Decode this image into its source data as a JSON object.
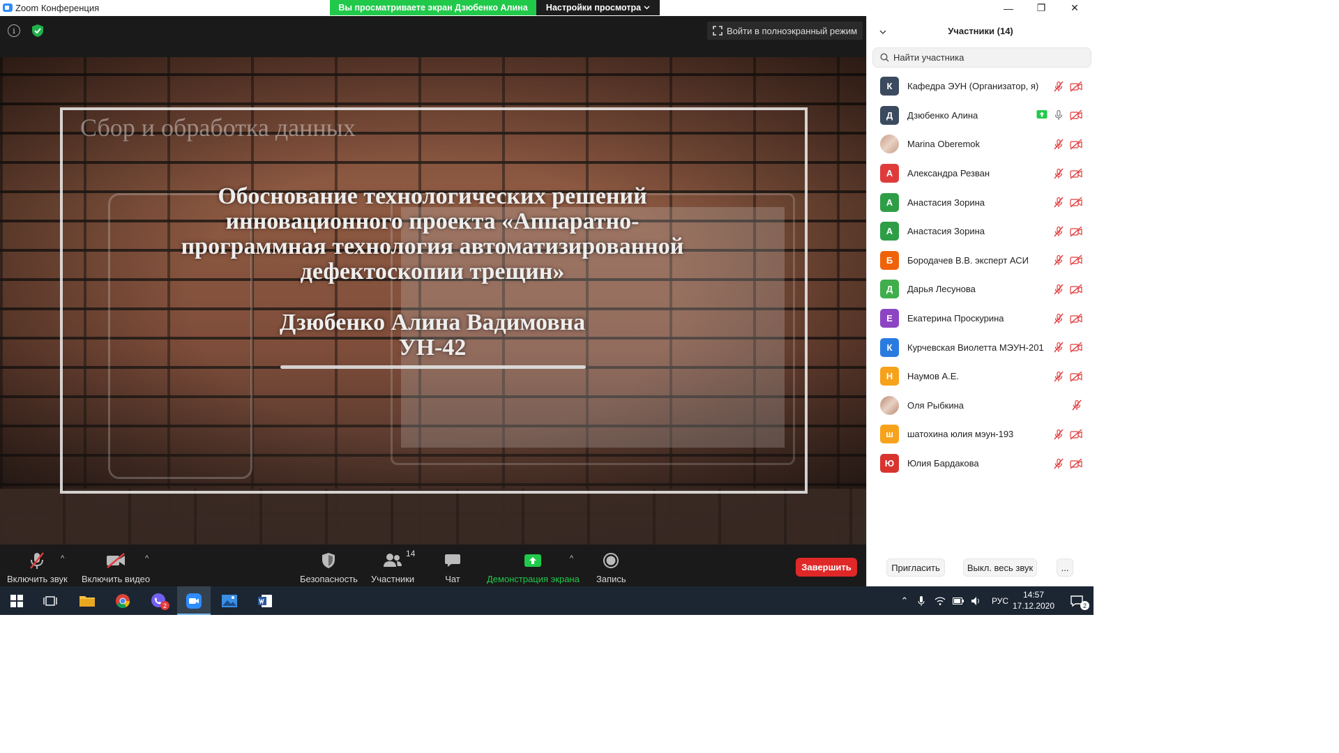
{
  "window": {
    "title": "Zoom Конференция",
    "minimize_glyph": "—",
    "restore_glyph": "❐",
    "close_glyph": "✕"
  },
  "share_banner": {
    "viewing_text": "Вы просматриваете экран Дзюбенко Алина",
    "view_settings_label": "Настройки просмотра"
  },
  "meeting_topbar": {
    "info_glyph": "i",
    "fullscreen_label": "Войти в полноэкранный режим"
  },
  "slide": {
    "header": "Сбор и обработка данных",
    "title_lines": [
      "Обоснование технологических решений",
      "инновационного проекта «Аппаратно-",
      "программная технология автоматизированной",
      "дефектоскопии трещин»"
    ],
    "author_lines": [
      "Дзюбенко Алина Вадимовна",
      "УН-42"
    ]
  },
  "toolbar": {
    "unmute_label": "Включить звук",
    "start_video_label": "Включить видео",
    "security_label": "Безопасность",
    "participants_label": "Участники",
    "participants_count": "14",
    "chat_label": "Чат",
    "share_screen_label": "Демонстрация экрана",
    "record_label": "Запись",
    "end_label": "Завершить",
    "caret_glyph": "^"
  },
  "panel": {
    "title": "Участники (14)",
    "search_placeholder": "Найти участника",
    "participants": [
      {
        "initial": "К",
        "name": "Кафедра ЭУН (Организатор, я)",
        "color": "#3b4a5e",
        "mic": "muted",
        "video": "off"
      },
      {
        "initial": "Д",
        "name": "Дзюбенко Алина",
        "color": "#3b4a5e",
        "mic": "on",
        "video": "off",
        "sharing": true
      },
      {
        "initial": "",
        "name": "Marina Oberemok",
        "color": "#c89a86",
        "mic": "muted",
        "video": "off",
        "photo": true
      },
      {
        "initial": "А",
        "name": "Александра Резван",
        "color": "#e03b3b",
        "mic": "muted",
        "video": "off"
      },
      {
        "initial": "А",
        "name": "Анастасия Зорина",
        "color": "#2e9e46",
        "mic": "muted",
        "video": "off"
      },
      {
        "initial": "А",
        "name": "Анастасия Зорина",
        "color": "#2e9e46",
        "mic": "muted",
        "video": "off"
      },
      {
        "initial": "Б",
        "name": "Бородачев В.В. эксперт АСИ",
        "color": "#f0620a",
        "mic": "muted",
        "video": "off"
      },
      {
        "initial": "Д",
        "name": "Дарья Лесунова",
        "color": "#3fae4b",
        "mic": "muted",
        "video": "off"
      },
      {
        "initial": "Е",
        "name": "Екатерина Проскурина",
        "color": "#8c44c4",
        "mic": "muted",
        "video": "off"
      },
      {
        "initial": "К",
        "name": "Курчевская Виолетта МЭУН-201",
        "color": "#2a7be0",
        "mic": "muted",
        "video": "off"
      },
      {
        "initial": "Н",
        "name": "Наумов А.Е.",
        "color": "#f7a21b",
        "mic": "muted",
        "video": "off"
      },
      {
        "initial": "",
        "name": "Оля Рыбкина",
        "color": "#b9876e",
        "mic": "muted",
        "video": "none",
        "photo": true
      },
      {
        "initial": "ш",
        "name": "шатохина юлия мэун-193",
        "color": "#f7a21b",
        "mic": "muted",
        "video": "off"
      },
      {
        "initial": "Ю",
        "name": "Юлия Бардакова",
        "color": "#d9332e",
        "mic": "muted",
        "video": "off"
      }
    ],
    "invite_label": "Пригласить",
    "mute_all_label": "Выкл. весь звук",
    "more_label": "..."
  },
  "taskbar": {
    "language": "РУС",
    "time": "14:57",
    "date": "17.12.2020",
    "viber_badge": "2",
    "notification_count": "2"
  },
  "colors": {
    "banner_green": "#21c94b",
    "end_red": "#e02828",
    "share_green": "#21c94b",
    "muted_red": "#e23b3b"
  }
}
